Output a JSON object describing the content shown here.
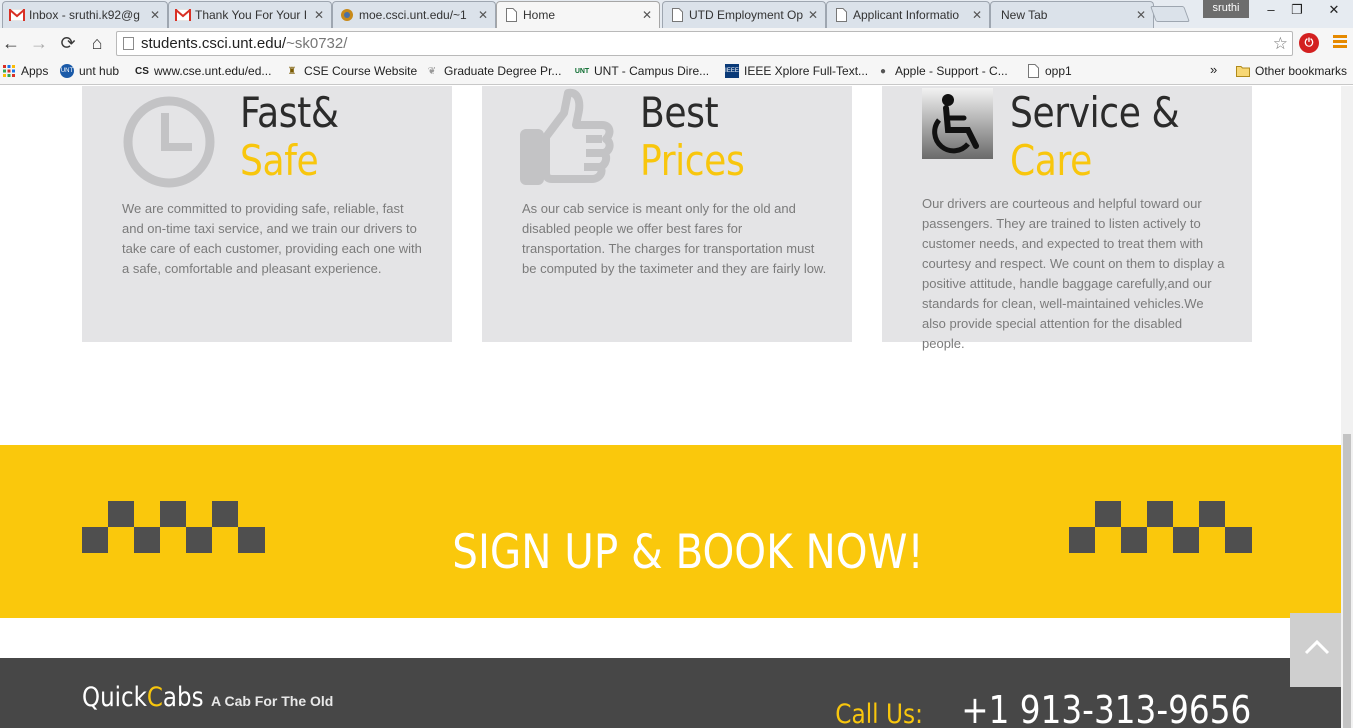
{
  "browser": {
    "tabs": [
      {
        "title": "Inbox - sruthi.k92@g",
        "icon": "gmail-icon"
      },
      {
        "title": "Thank You For Your I",
        "icon": "gmail-icon"
      },
      {
        "title": "moe.csci.unt.edu/~1",
        "icon": "shield-icon"
      },
      {
        "title": "Home",
        "icon": "page-icon",
        "active": true
      },
      {
        "title": "UTD Employment Op",
        "icon": "page-icon"
      },
      {
        "title": "Applicant Informatio",
        "icon": "page-icon"
      },
      {
        "title": "New Tab",
        "icon": "none"
      }
    ],
    "user": "sruthi",
    "url_host": "students.csci.unt.edu/",
    "url_path": "~sk0732/",
    "bookmarks": [
      {
        "label": "Apps",
        "icon": "apps-icon"
      },
      {
        "label": "unt hub",
        "icon": "unt-icon"
      },
      {
        "label": "www.cse.unt.edu/ed...",
        "icon": "cse-icon"
      },
      {
        "label": "CSE Course Website",
        "icon": "course-icon"
      },
      {
        "label": "Graduate Degree Pr...",
        "icon": "bird-icon"
      },
      {
        "label": "UNT - Campus Dire...",
        "icon": "unt-logo-icon"
      },
      {
        "label": "IEEE Xplore Full-Text...",
        "icon": "ieee-icon"
      },
      {
        "label": "Apple - Support - C...",
        "icon": "apple-icon"
      },
      {
        "label": "opp1",
        "icon": "page-icon"
      }
    ],
    "more_bookmarks": "»",
    "other_bookmarks": "Other bookmarks"
  },
  "features": [
    {
      "icon": "clock-icon",
      "heading_line1": "Fast&",
      "heading_line2": "Safe",
      "text": "We are committed to providing safe, reliable, fast and on-time taxi service, and we train our drivers to take care of each customer, providing each one with a safe, comfortable and pleasant experience."
    },
    {
      "icon": "thumbs-up-icon",
      "heading_line1": "Best",
      "heading_line2": "Prices",
      "text": "As our cab service is meant only for the old and disabled people we offer best fares for transportation. The charges for transportation must be computed by the taximeter and they are fairly low."
    },
    {
      "icon": "wheelchair-icon",
      "heading_line1": "Service &",
      "heading_line2": "Care",
      "text": "Our drivers are courteous and helpful toward our passengers. They are trained to listen actively to customer needs, and expected to treat them with courtesy and respect. We count on them to display a positive attitude, handle baggage carefully,and our standards for clean, well-maintained vehicles.We also provide special attention for the disabled people."
    }
  ],
  "cta": {
    "text": "SIGN UP & BOOK NOW!",
    "color": "#fac80c"
  },
  "footer": {
    "brand_a": "Quick",
    "brand_b": "C",
    "brand_c": "abs",
    "tagline": "A Cab For The Old",
    "call_label": "Call Us:",
    "phone": "+1 913-313-9656"
  },
  "colors": {
    "accent": "#f8c60d",
    "card": "#e4e4e6",
    "footer": "#474747"
  }
}
